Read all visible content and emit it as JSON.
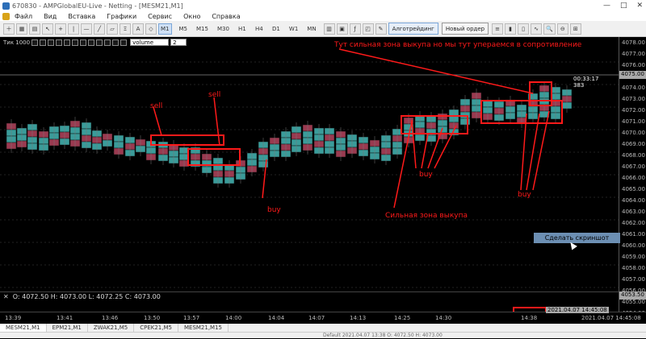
{
  "window": {
    "title": "670830 - AMPGlobalEU-Live - Netting - [MESM21,M1]"
  },
  "menu": [
    "Файл",
    "Вид",
    "Вставка",
    "Графики",
    "Сервис",
    "Окно",
    "Справка"
  ],
  "toolbar": {
    "timeframes": [
      "M1",
      "M5",
      "M15",
      "M30",
      "H1",
      "H4",
      "D1",
      "W1",
      "MN"
    ],
    "active_tf": "M1",
    "algo_label": "Алготрейдинг",
    "order_label": "Новый ордер"
  },
  "chart_ctrl": {
    "tick_label": "Тик 1000",
    "indicator_select": "volume",
    "indicator_value": "2"
  },
  "price_axis": {
    "labels": [
      "4078.00",
      "4077.00",
      "4076.00",
      "4074.00",
      "4073.00",
      "4072.00",
      "4071.00",
      "4070.00",
      "4069.00",
      "4068.00",
      "4067.00",
      "4066.00",
      "4065.00",
      "4064.00",
      "4063.00",
      "4062.00",
      "4061.00",
      "4060.00",
      "4059.00",
      "4058.00",
      "4057.00",
      "4056.00",
      "4055.00",
      "4054.00"
    ],
    "highlight_top": "4075.00",
    "highlight_bottom": "4053.50",
    "timer": "00:33:17",
    "timer_val": "383"
  },
  "ohlc": {
    "text": "O: 4072.50  H: 4073.00  L: 4072.25  C: 4073.00"
  },
  "time_axis": {
    "labels": [
      "13:39",
      "13:41",
      "13:46",
      "13:50",
      "13:57",
      "14:00",
      "14:04",
      "14:07",
      "14:13",
      "14:25",
      "14:30",
      "14:38"
    ],
    "right_date": "2021.04.07 14:45:08",
    "crosshair_date": "2021.04.07 14:45:08"
  },
  "tabs": [
    "MESM21,M1",
    "EPM21,M1",
    "ZWAK21,M5",
    "CPEK21,M5",
    "MESM21,M15"
  ],
  "status": {
    "text": "Default        2021.04.07 13:38    O: 4072.50    H: 4073.00"
  },
  "screenshot_button": "Сделать скриншот",
  "annotations": {
    "top": "Тут сильная зона выкупа но мы тут упераемся в сопротивление",
    "sell1": "sell",
    "sell2": "sell",
    "buy1": "buy",
    "buy2": "buy",
    "buy3": "buy",
    "zone": "Сильная зона выкупа"
  },
  "colors": {
    "annotation": "#ff1a1a",
    "bull": "#3a9c9a",
    "bear": "#9a3a50"
  }
}
